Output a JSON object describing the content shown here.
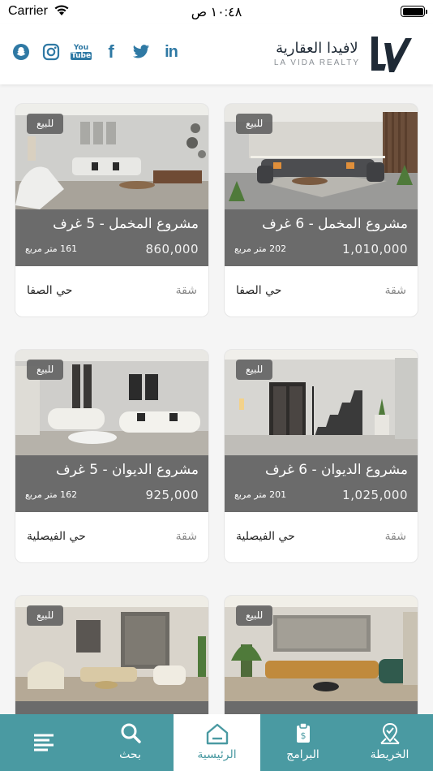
{
  "status_bar": {
    "carrier": "Carrier",
    "time": "١٠:٤٨ ص"
  },
  "header": {
    "logo_arabic": "لافيدا العقارية",
    "logo_english": "LA VIDA REALTY",
    "social_icons": [
      "snapchat-icon",
      "instagram-icon",
      "youtube-icon",
      "facebook-icon",
      "twitter-icon",
      "linkedin-icon"
    ],
    "youtube_text_top": "You",
    "youtube_text_bottom": "Tube",
    "facebook_glyph": "f",
    "linkedin_glyph": "in"
  },
  "listings": [
    {
      "badge": "للبيع",
      "title": "مشروع المخمل - 6 غرف",
      "price": "1,010,000",
      "area": "202 متر مربع",
      "type": "شقة",
      "district": "حي الصفا"
    },
    {
      "badge": "للبيع",
      "title": "مشروع المخمل - 5 غرف",
      "price": "860,000",
      "area": "161 متر مربع",
      "type": "شقة",
      "district": "حي الصفا"
    },
    {
      "badge": "للبيع",
      "title": "مشروع الديوان - 6 غرف",
      "price": "1,025,000",
      "area": "201 متر مربع",
      "type": "شقة",
      "district": "حي الفيصلية"
    },
    {
      "badge": "للبيع",
      "title": "مشروع الديوان - 5 غرف",
      "price": "925,000",
      "area": "162 متر مربع",
      "type": "شقة",
      "district": "حي الفيصلية"
    },
    {
      "badge": "للبيع"
    },
    {
      "badge": "للبيع"
    }
  ],
  "tab_bar": {
    "tabs": [
      {
        "label": "الخريطة",
        "icon": "map-pin-icon"
      },
      {
        "label": "البرامج",
        "icon": "clipboard-icon"
      },
      {
        "label": "الرئيسية",
        "icon": "home-icon",
        "active": true
      },
      {
        "label": "بحث",
        "icon": "search-icon"
      },
      {
        "label": "",
        "icon": "menu-icon"
      }
    ]
  },
  "colors": {
    "accent": "#4a9aa2",
    "social": "#2f79a4",
    "card_info_bg": "#6b6b6b"
  }
}
